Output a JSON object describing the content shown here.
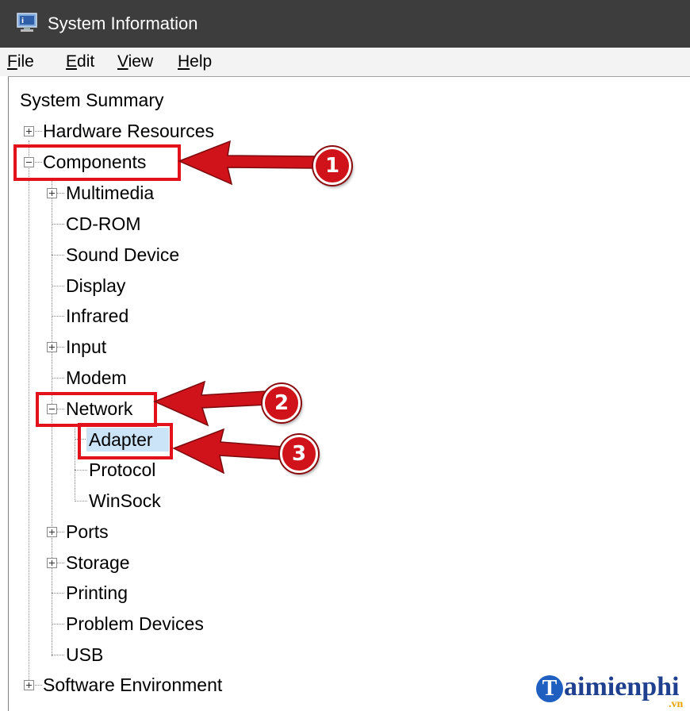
{
  "window": {
    "title": "System Information",
    "icon": "system-information-icon"
  },
  "menu": [
    {
      "label": "File",
      "accel": "F",
      "rest": "ile"
    },
    {
      "label": "Edit",
      "accel": "E",
      "rest": "dit"
    },
    {
      "label": "View",
      "accel": "V",
      "rest": "iew"
    },
    {
      "label": "Help",
      "accel": "H",
      "rest": "elp"
    }
  ],
  "tree": {
    "root": "System Summary",
    "hardware_resources": "Hardware Resources",
    "components": "Components",
    "multimedia": "Multimedia",
    "cd_rom": "CD-ROM",
    "sound_device": "Sound Device",
    "display": "Display",
    "infrared": "Infrared",
    "input": "Input",
    "modem": "Modem",
    "network": "Network",
    "adapter": "Adapter",
    "protocol": "Protocol",
    "winsock": "WinSock",
    "ports": "Ports",
    "storage": "Storage",
    "printing": "Printing",
    "problem_devices": "Problem Devices",
    "usb": "USB",
    "software_environment": "Software Environment"
  },
  "annotations": {
    "step1": "1",
    "step2": "2",
    "step3": "3",
    "highlight_color": "#e3111b",
    "arrow_color": "#d0121a"
  },
  "watermark": {
    "letter": "T",
    "text": "aimienphi",
    "suffix": ".vn"
  }
}
